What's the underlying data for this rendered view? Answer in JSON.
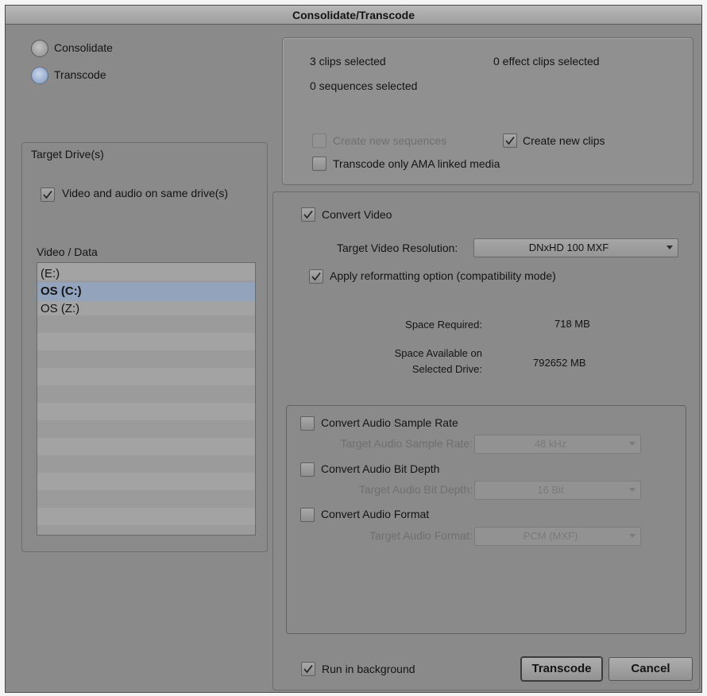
{
  "window": {
    "title": "Consolidate/Transcode"
  },
  "mode": {
    "options": [
      {
        "label": "Consolidate",
        "selected": false
      },
      {
        "label": "Transcode",
        "selected": true
      }
    ]
  },
  "target_drives": {
    "title": "Target Drive(s)",
    "same_drive_label": "Video and audio on same drive(s)",
    "same_drive_checked": true,
    "list_title": "Video / Data",
    "drives": [
      "(E:)",
      "OS (C:)",
      "OS (Z:)"
    ],
    "selected_drive": "OS (C:)"
  },
  "selection_info": {
    "clips": "3 clips selected",
    "effect_clips": "0 effect clips selected",
    "sequences": "0 sequences selected",
    "create_sequences_label": "Create new sequences",
    "create_sequences_checked": false,
    "create_clips_label": "Create new clips",
    "create_clips_checked": true,
    "ama_only_label": "Transcode only AMA linked media",
    "ama_only_checked": false
  },
  "video": {
    "convert_label": "Convert Video",
    "convert_checked": true,
    "resolution_label": "Target Video Resolution:",
    "resolution_value": "DNxHD 100  MXF",
    "reformat_label": "Apply reformatting option (compatibility mode)",
    "reformat_checked": true,
    "space_required_label": "Space Required:",
    "space_required_value": "718 MB",
    "space_available_label_1": "Space Available on",
    "space_available_label_2": "Selected Drive:",
    "space_available_value": "792652 MB"
  },
  "audio": {
    "sample_rate_label": "Convert Audio Sample Rate",
    "sample_rate_checked": false,
    "target_sample_rate_label": "Target Audio Sample Rate:",
    "target_sample_rate_value": "48 kHz",
    "bit_depth_label": "Convert Audio Bit Depth",
    "bit_depth_checked": false,
    "target_bit_depth_label": "Target Audio Bit Depth:",
    "target_bit_depth_value": "16 Bit",
    "format_label": "Convert Audio Format",
    "format_checked": false,
    "target_format_label": "Target Audio Format:",
    "target_format_value": "PCM  (MXF)"
  },
  "footer": {
    "background_label": "Run in background",
    "background_checked": true,
    "transcode_button": "Transcode",
    "cancel_button": "Cancel"
  },
  "icons": {
    "check": "check-icon",
    "dropdown": "chevron-down-icon"
  }
}
